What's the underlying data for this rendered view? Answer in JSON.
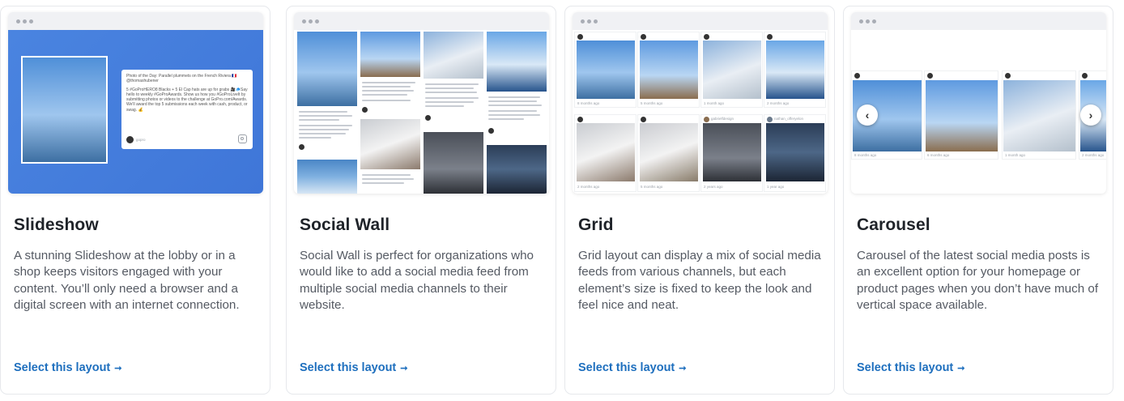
{
  "cards": [
    {
      "title": "Social Wall",
      "description": "Social Wall is perfect for organizations who would like to add a social media feed from multiple social media channels to their website.",
      "link": "Select this layout"
    },
    {
      "title": "Grid",
      "description": "Grid layout can display a mix of social media feeds from various channels, but each element’s size is fixed to keep the look and feel nice and neat.",
      "link": "Select this layout"
    },
    {
      "title": "Carousel",
      "description": "Carousel of the latest social media posts is an excellent option for your homepage or product pages when you don’t have much of vertical space available.",
      "link": "Select this layout"
    },
    {
      "title": "Slideshow",
      "description": "A stunning Slideshow at the lobby or in a shop keeps visitors engaged with your content. You’ll only need a browser and a digital screen with an internet connection.",
      "link": "Select this layout"
    }
  ],
  "link_arrow": "➞",
  "grid_meta": {
    "handle": "gopro",
    "handle2": "gabrielfdesign",
    "handle3": "nathan_offeryelon",
    "t1": "8 months ago",
    "t2": "5 months ago",
    "t3": "1 month ago",
    "t4": "2 months ago",
    "t5": "2 years ago",
    "t6": "1 year ago"
  },
  "carousel_meta": {
    "t1": "8 months ago",
    "t2": "6 months ago",
    "t3": "1 month ago",
    "t4": "2 months ago",
    "prev": "‹",
    "next": "›"
  },
  "slideshow": {
    "headline": "Photo of the Day: Parallel plummets on the French Riviera 🇨🇵@thomashubener",
    "body": "5 #GoProHERO8 Blacks + 5 El Cap hats are up for grabs 🎥🧢Say hello to weekly #GoProAwards. Show us how you #GoProLiveIt by submitting photos or videos to the challenge at GoPro.com/Awards. We'll award the top 5 submissions each week with cash, product, or swag. 💰",
    "handle": "gopro"
  },
  "colors": {
    "link": "#1e6fbe",
    "slideshow_bg": "#4a84e0"
  }
}
